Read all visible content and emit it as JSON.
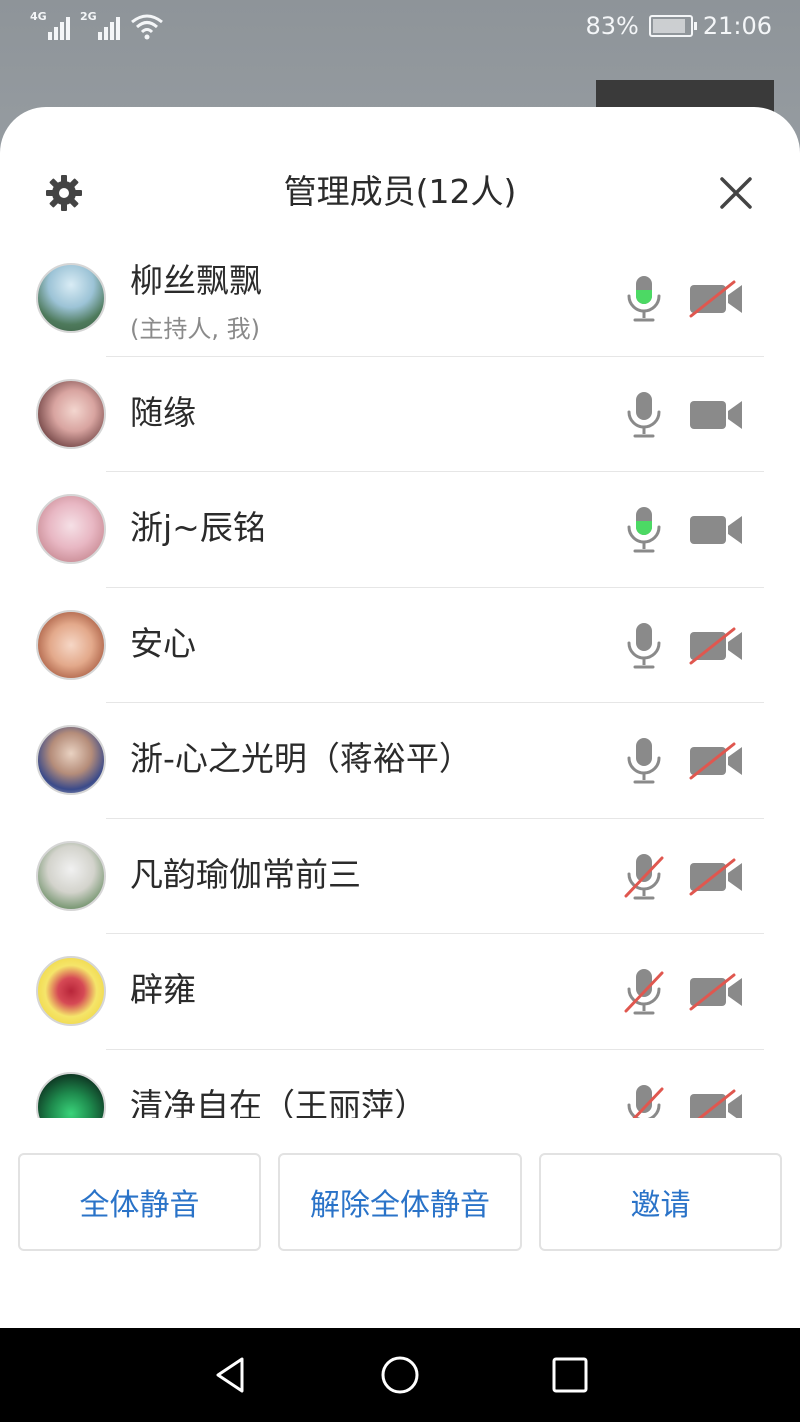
{
  "status_bar": {
    "network_1": "4G",
    "network_2": "2G",
    "battery": "83%",
    "time": "21:06"
  },
  "header": {
    "title": "管理成员(12人)",
    "settings_icon": "gear-icon",
    "close_icon": "close-icon"
  },
  "members": [
    {
      "name": "柳丝飘飘",
      "sub": "(主持人, 我)",
      "mic": "active",
      "camera": "off"
    },
    {
      "name": "随缘",
      "sub": "",
      "mic": "on",
      "camera": "on"
    },
    {
      "name": "浙j~辰铭",
      "sub": "",
      "mic": "active",
      "camera": "on"
    },
    {
      "name": "安心",
      "sub": "",
      "mic": "on",
      "camera": "off"
    },
    {
      "name": "浙-心之光明（蒋裕平）",
      "sub": "",
      "mic": "on",
      "camera": "off"
    },
    {
      "name": "凡韵瑜伽常前三",
      "sub": "",
      "mic": "off",
      "camera": "off"
    },
    {
      "name": "辟雍",
      "sub": "",
      "mic": "off",
      "camera": "off"
    },
    {
      "name": "清净自在（王丽萍）",
      "sub": "",
      "mic": "off",
      "camera": "off"
    }
  ],
  "actions": {
    "mute_all": "全体静音",
    "unmute_all": "解除全体静音",
    "invite": "邀请"
  },
  "colors": {
    "accent": "#2a73c8",
    "mic_active": "#4cd964",
    "disabled_slash": "#e0574f",
    "icon_gray": "#8a8a8a"
  }
}
